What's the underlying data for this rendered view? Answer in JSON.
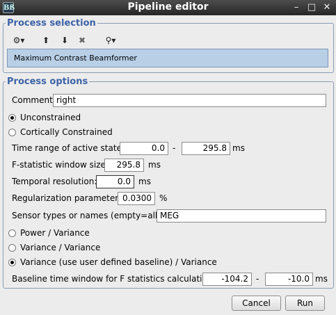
{
  "window": {
    "title": "Pipeline editor",
    "app_icon": "Bß",
    "minimize": "–",
    "maximize": "□",
    "close": "✕"
  },
  "process_selection": {
    "label": "Process selection",
    "toolbar": {
      "gear": "⚙▾",
      "up": "⬆",
      "down": "⬇",
      "remove": "✖",
      "tree": "⚲▾"
    },
    "selected_process": "Maximum Contrast Beamformer"
  },
  "process_options": {
    "label": "Process options",
    "comment": {
      "label": "Comment:",
      "value": "right"
    },
    "constraint": {
      "unconstrained": "Unconstrained",
      "cortical": "Cortically Constrained",
      "selected": "unconstrained"
    },
    "time_range": {
      "label": "Time range of active state:",
      "start": "0.0",
      "dash": "-",
      "end": "295.8",
      "unit": "ms"
    },
    "fstat_window": {
      "label": "F-statistic window size:",
      "value": "295.8",
      "unit": "ms"
    },
    "temporal_res": {
      "label": "Temporal resolution:",
      "value": "0.0",
      "unit": "ms"
    },
    "regularization": {
      "label": "Regularization parameter:",
      "value": "0.0300",
      "unit": "%"
    },
    "sensors": {
      "label": "Sensor types or names (empty=all):",
      "value": "MEG"
    },
    "method": {
      "power_variance": "Power / Variance",
      "variance_variance": "Variance / Variance",
      "variance_baseline": "Variance (use user defined baseline) / Variance",
      "selected": "variance_baseline"
    },
    "baseline": {
      "label": "Baseline time window for F statistics calculation:",
      "start": "-104.2",
      "dash": "-",
      "end": "-10.0",
      "unit": "ms"
    }
  },
  "buttons": {
    "cancel": "Cancel",
    "run": "Run"
  }
}
